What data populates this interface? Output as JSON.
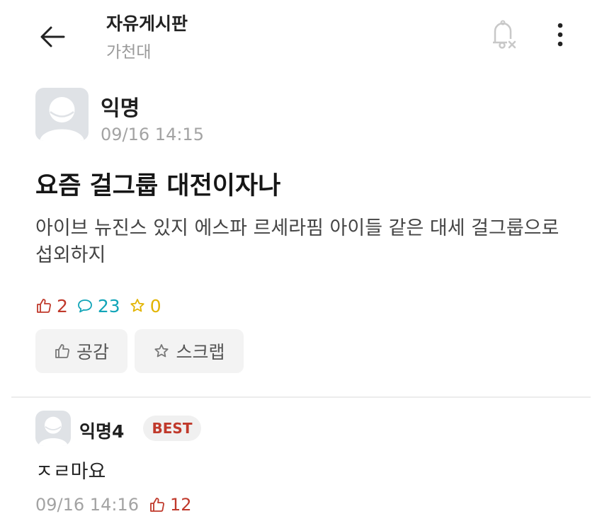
{
  "header": {
    "title": "자유게시판",
    "subtitle": "가천대",
    "icons": {
      "back": "arrow-left-icon",
      "bell": "bell-off-icon",
      "more": "more-vertical-icon"
    }
  },
  "post": {
    "author": "익명",
    "time": "09/16 14:15",
    "title": "요즘 걸그룹 대전이자나",
    "body": "아이브 뉴진스 있지 에스파 르세라핌 아이들 같은 대세 걸그룹으로 섭외하지",
    "likes": "2",
    "comments": "23",
    "scraps": "0",
    "like_button": "공감",
    "scrap_button": "스크랩"
  },
  "comment": {
    "author": "익명4",
    "badge": "BEST",
    "body": "ㅈㄹ마요",
    "time": "09/16 14:16",
    "likes": "12"
  },
  "colors": {
    "like": "#c0392b",
    "comment": "#12a5b8",
    "scrap": "#e2b400",
    "muted": "#a3a3a3",
    "avatar_bg": "#dfe2e6"
  }
}
